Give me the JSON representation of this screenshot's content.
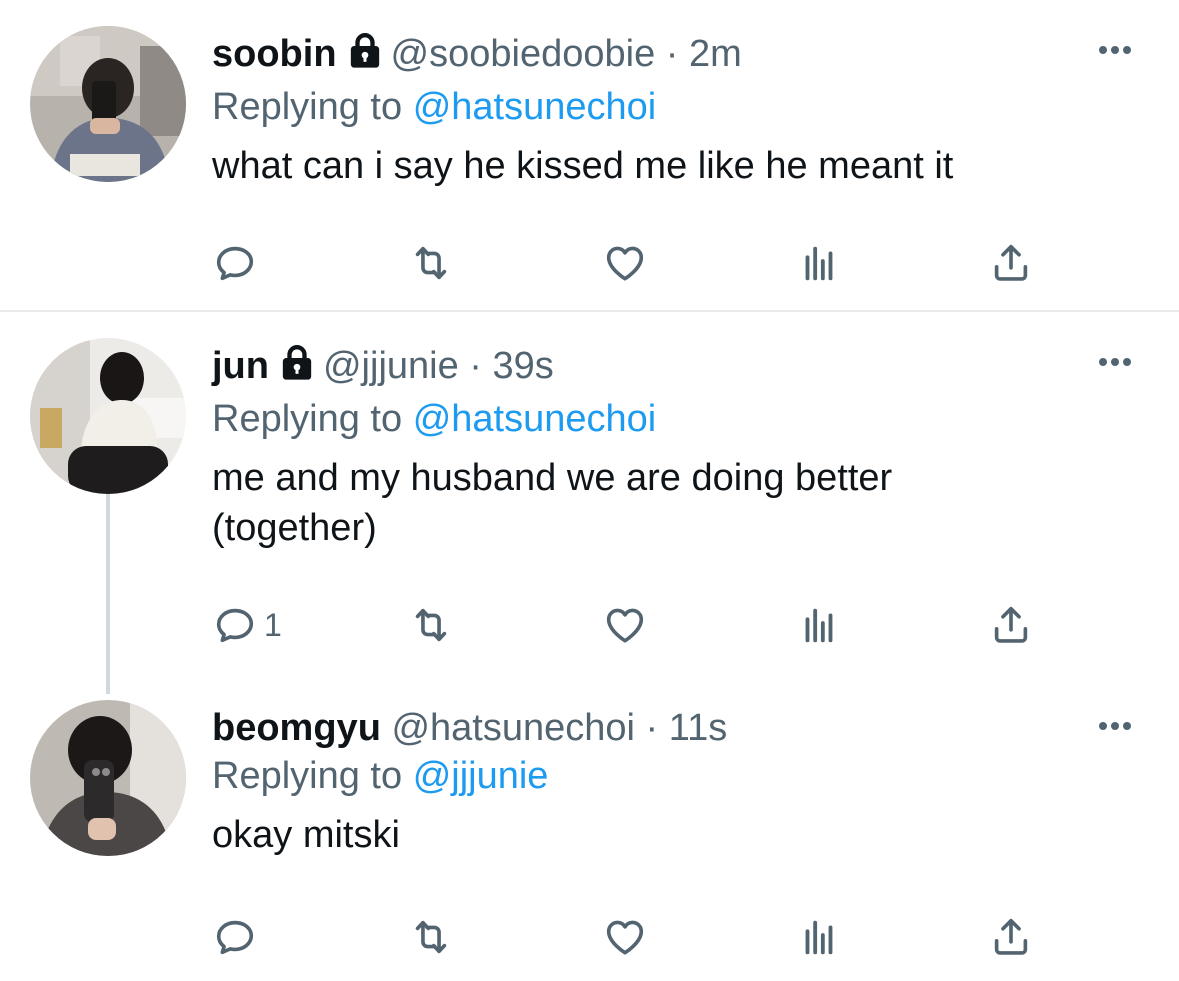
{
  "tweets": [
    {
      "name": "soobin",
      "locked": true,
      "handle": "@soobiedoobie",
      "separator": "·",
      "time": "2m",
      "replying_prefix": "Replying to",
      "replying_to": "@hatsunechoi",
      "text": "what can i say he kissed me like he meant it",
      "reply_count": ""
    },
    {
      "name": "jun",
      "locked": true,
      "handle": "@jjjunie",
      "separator": "·",
      "time": "39s",
      "replying_prefix": "Replying to",
      "replying_to": "@hatsunechoi",
      "text": "me and my husband we are doing better\n(together)",
      "reply_count": "1"
    },
    {
      "name": "beomgyu",
      "locked": false,
      "handle": "@hatsunechoi",
      "separator": "·",
      "time": "11s",
      "replying_prefix": "Replying to",
      "replying_to": "@jjjunie",
      "text": "okay mitski",
      "reply_count": ""
    }
  ],
  "icons": {
    "reply": "reply-icon",
    "retweet": "retweet-icon",
    "like": "heart-icon",
    "analytics": "analytics-icon",
    "share": "share-icon",
    "more": "more-icon",
    "lock": "lock-icon"
  },
  "colors": {
    "text": "#0f1419",
    "secondary": "#536471",
    "mention": "#1d9bf0",
    "divider": "#e7e9eb",
    "thread_line": "#cfd9de"
  }
}
